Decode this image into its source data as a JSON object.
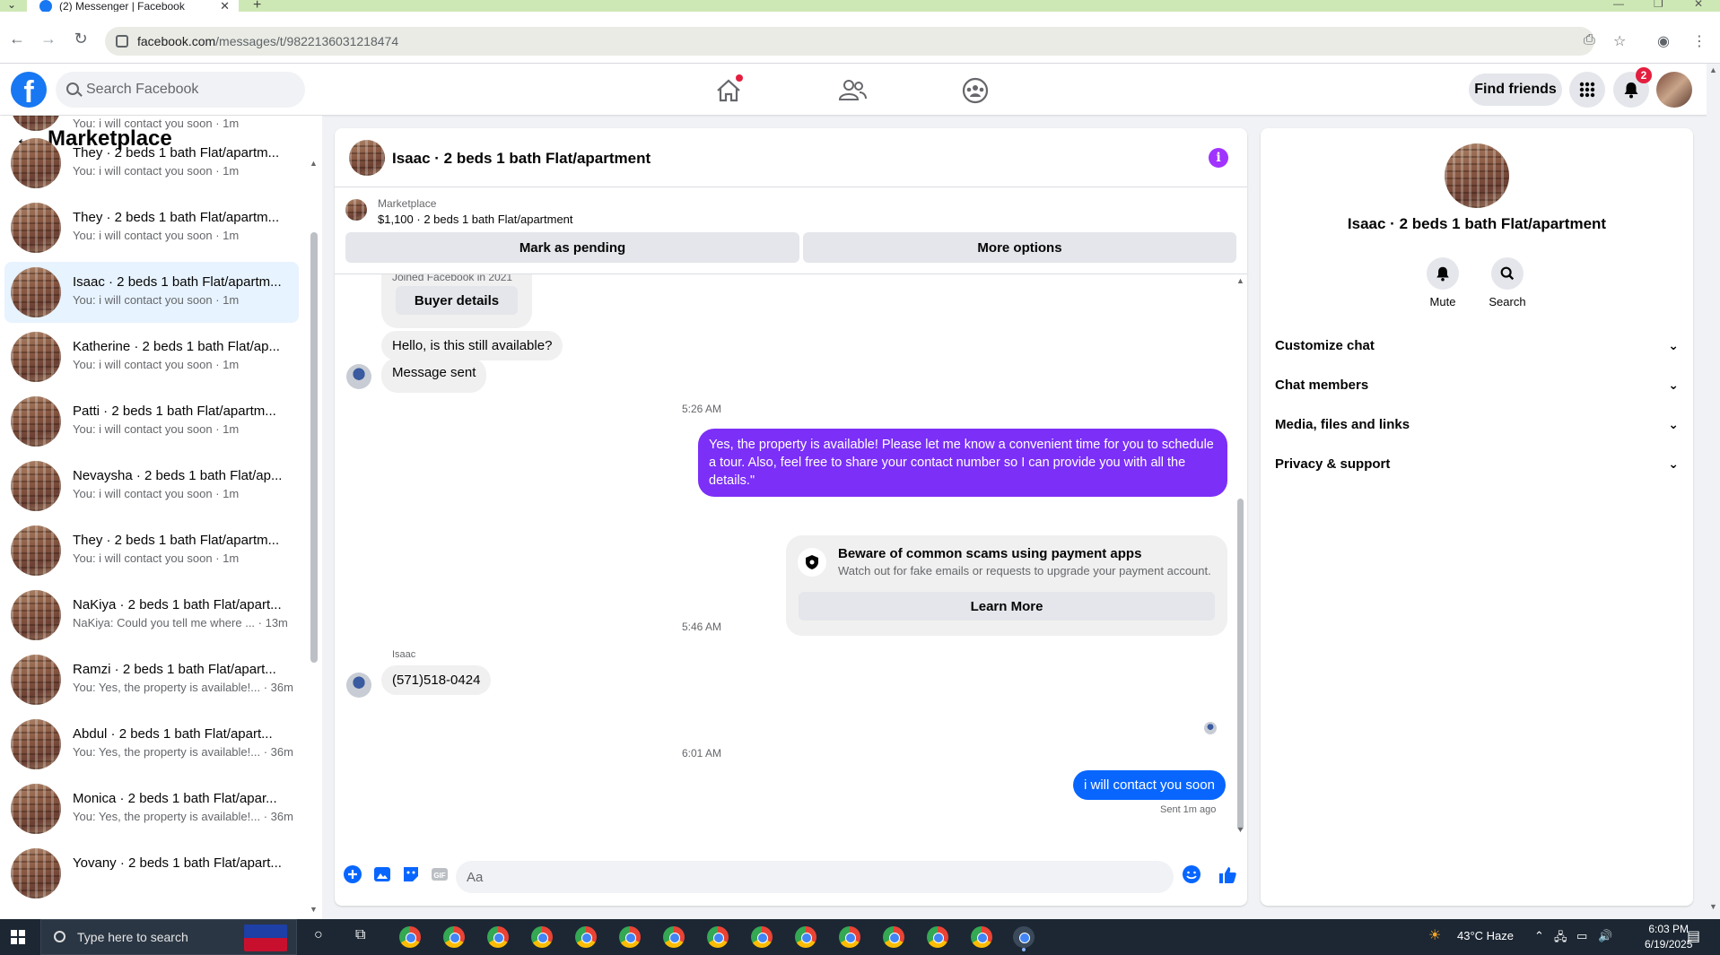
{
  "browser": {
    "tab_title": "(2) Messenger | Facebook",
    "url_domain": "facebook.com",
    "url_path": "/messages/t/9822136031218474"
  },
  "fb_nav": {
    "search_placeholder": "Search Facebook",
    "find_friends": "Find friends",
    "notification_count": "2",
    "brand_color": "#1877f2"
  },
  "sidebar": {
    "title": "Marketplace",
    "partial_top": "You: i will contact you soon · 1m",
    "items": [
      {
        "name": "They · 2 beds 1 bath Flat/apartm...",
        "last": "You: i will contact you soon · 1m"
      },
      {
        "name": "They · 2 beds 1 bath Flat/apartm...",
        "last": "You: i will contact you soon · 1m"
      },
      {
        "name": "Isaac · 2 beds 1 bath Flat/apartm...",
        "last": "You: i will contact you soon · 1m"
      },
      {
        "name": "Katherine · 2 beds 1 bath Flat/ap...",
        "last": "You: i will contact you soon · 1m"
      },
      {
        "name": "Patti · 2 beds 1 bath Flat/apartm...",
        "last": "You: i will contact you soon · 1m"
      },
      {
        "name": "Nevaysha · 2 beds 1 bath Flat/ap...",
        "last": "You: i will contact you soon · 1m"
      },
      {
        "name": "They · 2 beds 1 bath Flat/apartm...",
        "last": "You: i will contact you soon · 1m"
      },
      {
        "name": "NaKiya · 2 beds 1 bath Flat/apart...",
        "last": "NaKiya: Could you tell me where ... · 13m"
      },
      {
        "name": "Ramzi · 2 beds 1 bath Flat/apart...",
        "last": "You: Yes, the property is available!... · 36m"
      },
      {
        "name": "Abdul · 2 beds 1 bath Flat/apart...",
        "last": "You: Yes, the property is available!... · 36m"
      },
      {
        "name": "Monica · 2 beds 1 bath Flat/apar...",
        "last": "You: Yes, the property is available!... · 36m"
      },
      {
        "name": "Yovany · 2 beds 1 bath Flat/apart...",
        "last": ""
      }
    ]
  },
  "chat": {
    "title": "Isaac · 2 beds 1 bath Flat/apartment",
    "marketplace_label": "Marketplace",
    "listing": "$1,100 · 2 beds 1 bath Flat/apartment",
    "mark_pending": "Mark as pending",
    "more_options": "More options",
    "joined": "Joined Facebook in 2021",
    "buyer_details": "Buyer details",
    "msg_available": "Hello, is this still available?",
    "msg_sent": "Message sent",
    "time1": "5:26 AM",
    "reply_text": "Yes, the property is available! Please let me know a convenient time for you to schedule a tour. Also, feel free to share your contact number so I can provide you with all the details.\"",
    "scam_title": "Beware of common scams using payment apps",
    "scam_sub": "Watch out for fake emails or requests to upgrade your payment account.",
    "learn_more": "Learn More",
    "time2": "5:46 AM",
    "sender_name": "Isaac",
    "phone": "(571)518-0424",
    "time3": "6:01 AM",
    "my_msg": "i will contact you soon",
    "sent_status": "Sent 1m ago",
    "composer_placeholder": "Aa",
    "accent_purple": "#7b2ff7",
    "accent_blue": "#0866ff"
  },
  "panel": {
    "name": "Isaac · 2 beds 1 bath Flat/apartment",
    "mute": "Mute",
    "search": "Search",
    "rows": [
      "Customize chat",
      "Chat members",
      "Media, files and links",
      "Privacy & support"
    ]
  },
  "taskbar": {
    "search_placeholder": "Type here to search",
    "weather": "43°C  Haze",
    "time": "6:03 PM",
    "date": "6/19/2025"
  }
}
